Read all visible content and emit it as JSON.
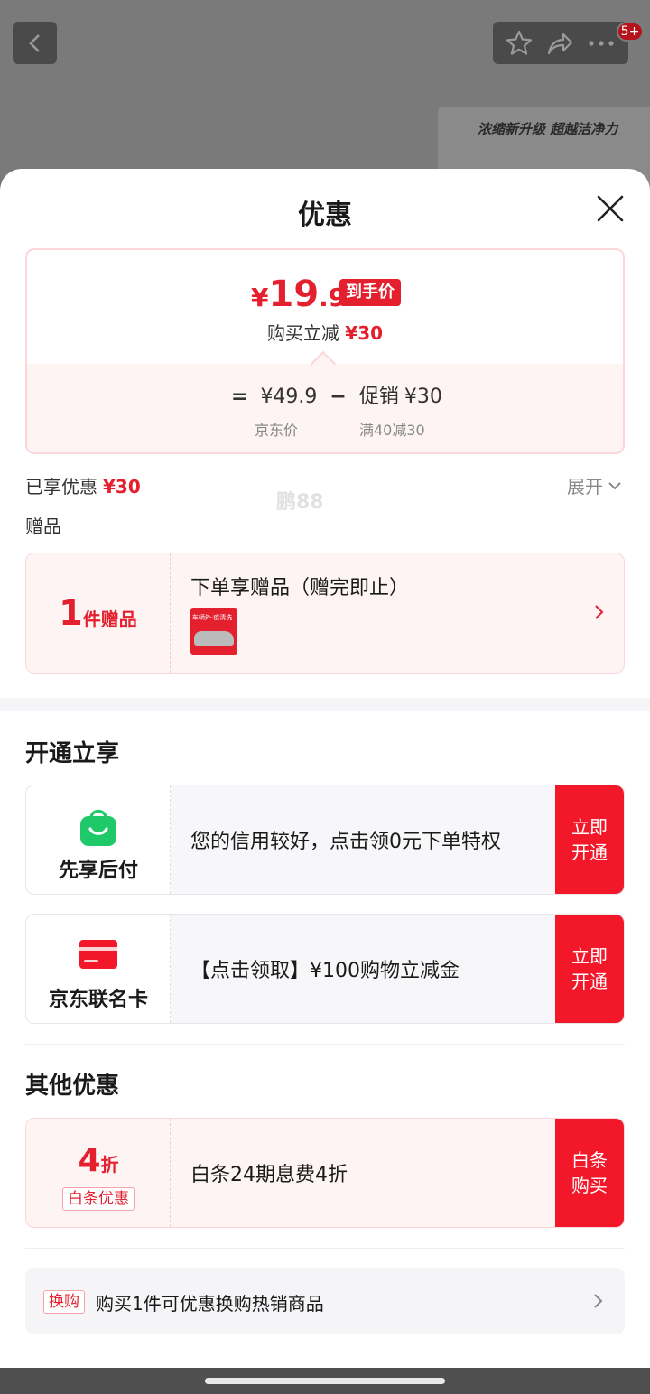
{
  "background": {
    "badge": "5+",
    "banner_text": "浓缩新升级 超越洁净力"
  },
  "sheet": {
    "title": "优惠"
  },
  "price": {
    "currency": "¥",
    "final_int": "19",
    "final_dec": ".9",
    "final_tag": "到手价",
    "reduce_prefix": "购买立减",
    "reduce_amount": "¥30",
    "equals": "=",
    "jd_price": "¥49.9",
    "minus": "−",
    "promo_label": "促销",
    "promo_amount": "¥30",
    "jd_price_label": "京东价",
    "promo_rule": "满40减30"
  },
  "enjoyed": {
    "label": "已享优惠",
    "amount": "¥30",
    "expand": "展开"
  },
  "gift": {
    "section_label": "赠品",
    "count": "1",
    "count_unit": "件赠品",
    "title": "下单享赠品（赠完即止）",
    "image_caption": "车辆外·疫清洗"
  },
  "watermark": "鹏88",
  "open_section": {
    "title": "开通立享",
    "offers": [
      {
        "name": "先享后付",
        "description": "您的信用较好，点击领0元下单特权",
        "button": "立即\n开通"
      },
      {
        "name": "京东联名卡",
        "description": "【点击领取】¥100购物立减金",
        "button": "立即\n开通"
      }
    ]
  },
  "other_section": {
    "title": "其他优惠",
    "offer": {
      "discount_num": "4",
      "discount_unit": "折",
      "tag": "白条优惠",
      "description": "白条24期息费4折",
      "button": "白条\n购买"
    }
  },
  "swap": {
    "tag": "换购",
    "text": "购买1件可优惠换购热销商品"
  },
  "colors": {
    "accent_red": "#e4202e",
    "button_red": "#f2182a",
    "pink_bg": "#fef4f4",
    "pay_later_green": "#1fc96a"
  }
}
